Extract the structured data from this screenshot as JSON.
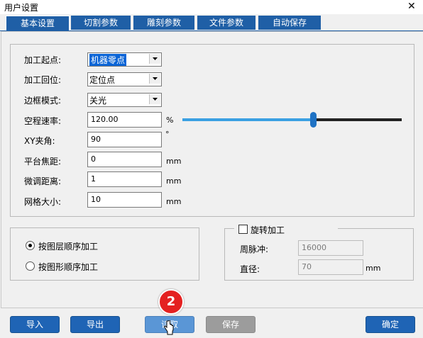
{
  "window": {
    "title": "用户设置",
    "close_glyph": "✕"
  },
  "tabs": [
    "基本设置",
    "切割参数",
    "雕刻参数",
    "文件参数",
    "自动保存"
  ],
  "settings": {
    "process_start": {
      "label": "加工起点:",
      "value": "机器零点"
    },
    "process_return": {
      "label": "加工回位:",
      "value": "定位点"
    },
    "frame_mode": {
      "label": "边框模式:",
      "value": "关光"
    },
    "idle_speed": {
      "label": "空程速率:",
      "value": "120.00",
      "unit": "%",
      "slider_fraction": 0.71
    },
    "xy_angle": {
      "label": "XY夹角:",
      "value": "90",
      "unit": "°"
    },
    "platform_focus": {
      "label": "平台焦距:",
      "value": "0",
      "unit": "mm"
    },
    "fine_adjust": {
      "label": "微调距离:",
      "value": "1",
      "unit": "mm"
    },
    "grid_size": {
      "label": "网格大小:",
      "value": "10",
      "unit": "mm"
    }
  },
  "order": {
    "by_layer": "按图层顺序加工",
    "by_shape": "按图形顺序加工"
  },
  "rotary": {
    "checkbox_label": "旋转加工",
    "pulse": {
      "label": "周脉冲:",
      "value": "16000"
    },
    "diameter": {
      "label": "直径:",
      "value": "70",
      "unit": "mm"
    }
  },
  "buttons": {
    "import": "导入",
    "export": "导出",
    "read": "读取",
    "save": "保存",
    "ok": "确定"
  },
  "annotation": {
    "step": "2"
  },
  "colors": {
    "tab_blue": "#1f5fa6",
    "slider_blue": "#3aa0e2",
    "badge_red": "#e42121"
  }
}
